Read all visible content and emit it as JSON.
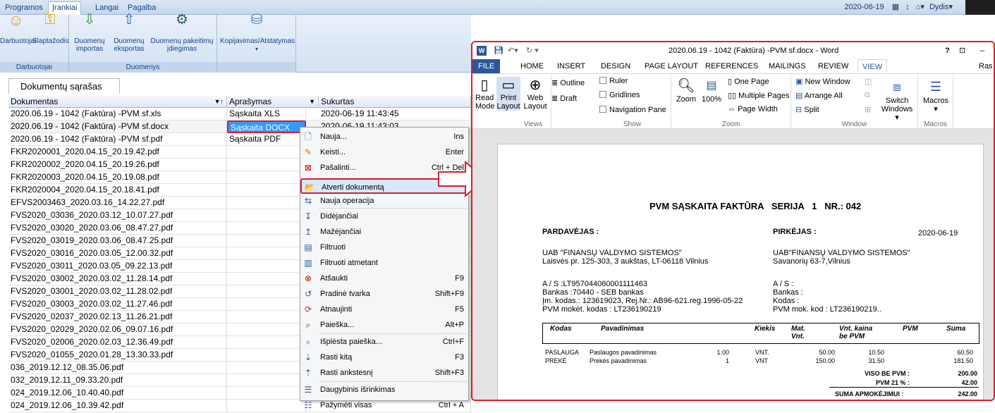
{
  "menubar": {
    "tabs": [
      "Programos",
      "Įrankiai",
      "Langai",
      "Pagalba"
    ],
    "date": "2020-06-19",
    "user": "Dydis"
  },
  "ribbon": {
    "groups": [
      {
        "label": "Darbuotojai",
        "buttons": [
          "Darbuotojai",
          "Slaptažodis"
        ]
      },
      {
        "label": "Duomenys",
        "buttons": [
          "Duomenų importas",
          "Duomenų eksportas",
          "Duomenų pakeitimų įdiegimas"
        ]
      },
      {
        "label": "",
        "buttons": [
          "Kopijavimas/Atstatymas"
        ]
      }
    ]
  },
  "list": {
    "title": "Dokumentų sąrašas",
    "columns": [
      "Dokumentas",
      "Aprašymas",
      "Sukurtas"
    ],
    "rows": [
      [
        "2020.06.19 - 1042 (Faktūra) -PVM sf.xls",
        "Sąskaita XLS",
        "2020-06-19 11:43:45"
      ],
      [
        "2020.06.19 - 1042 (Faktūra) -PVM sf.docx",
        "Sąskaita DOCX",
        "2020-06-19 11:43:03"
      ],
      [
        "2020.06.19 - 1042 (Faktūra) -PVM sf.pdf",
        "Sąskaita PDF",
        ""
      ],
      [
        "FKR2020001_2020.04.15_20.19.42.pdf",
        "",
        ""
      ],
      [
        "FKR2020002_2020.04.15_20.19.26.pdf",
        "",
        ""
      ],
      [
        "FKR2020003_2020.04.15_20.19.08.pdf",
        "",
        ""
      ],
      [
        "FKR2020004_2020.04.15_20.18.41.pdf",
        "",
        ""
      ],
      [
        "EFVS2003463_2020.03.16_14.22.27.pdf",
        "",
        ""
      ],
      [
        "FVS2020_03036_2020.03.12_10.07.27.pdf",
        "",
        ""
      ],
      [
        "FVS2020_03020_2020.03.06_08.47.27.pdf",
        "",
        ""
      ],
      [
        "FVS2020_03019_2020.03.06_08.47.25.pdf",
        "",
        ""
      ],
      [
        "FVS2020_03016_2020.03.05_12.00.32.pdf",
        "",
        ""
      ],
      [
        "FVS2020_03011_2020.03.05_09.22.13.pdf",
        "",
        ""
      ],
      [
        "FVS2020_03002_2020.03.02_11.28.14.pdf",
        "",
        ""
      ],
      [
        "FVS2020_03001_2020.03.02_11.28.02.pdf",
        "",
        ""
      ],
      [
        "FVS2020_03003_2020.03.02_11.27.46.pdf",
        "",
        ""
      ],
      [
        "FVS2020_02037_2020.02.13_11.26.21.pdf",
        "",
        ""
      ],
      [
        "FVS2020_02029_2020.02.06_09.07.16.pdf",
        "",
        ""
      ],
      [
        "FVS2020_02006_2020.02.03_12.36.49.pdf",
        "",
        ""
      ],
      [
        "FVS2020_01055_2020.01.28_13.30.33.pdf",
        "",
        ""
      ],
      [
        "036_2019.12.12_08.35.06.pdf",
        "",
        ""
      ],
      [
        "032_2019.12.11_09.33.20.pdf",
        "",
        ""
      ],
      [
        "024_2019.12.06_10.40.40.pdf",
        "",
        ""
      ],
      [
        "024_2019.12.06_10.39.42.pdf",
        "",
        ""
      ]
    ]
  },
  "context_menu": {
    "items": [
      {
        "label": "Nauja...",
        "shortcut": "Ins",
        "icon": "new-doc-icon"
      },
      {
        "label": "Keisti...",
        "shortcut": "Enter",
        "icon": "edit-icon"
      },
      {
        "label": "Pašalinti...",
        "shortcut": "Ctrl + Del",
        "icon": "delete-icon"
      },
      {
        "label": "Atverti dokumentą",
        "shortcut": "",
        "icon": "open-doc-icon"
      },
      {
        "label": "Nauja operacija",
        "shortcut": "",
        "icon": "operation-icon"
      },
      {
        "label": "Didėjančiai",
        "shortcut": "",
        "icon": "sort-asc-icon"
      },
      {
        "label": "Mažėjančiai",
        "shortcut": "",
        "icon": "sort-desc-icon"
      },
      {
        "label": "Filtruoti",
        "shortcut": "",
        "icon": "filter-icon"
      },
      {
        "label": "Filtruoti atmetant",
        "shortcut": "",
        "icon": "filter-exclude-icon"
      },
      {
        "label": "Atšaukti",
        "shortcut": "F9",
        "icon": "cancel-icon"
      },
      {
        "label": "Pradinė tvarka",
        "shortcut": "Shift+F9",
        "icon": "reset-order-icon"
      },
      {
        "label": "Atnaujinti",
        "shortcut": "F5",
        "icon": "refresh-icon"
      },
      {
        "label": "Paieška...",
        "shortcut": "Alt+P",
        "icon": "search-icon"
      },
      {
        "label": "Išplėsta paieška...",
        "shortcut": "Ctrl+F",
        "icon": "advanced-search-icon"
      },
      {
        "label": "Rasti kitą",
        "shortcut": "F3",
        "icon": "find-next-icon"
      },
      {
        "label": "Rasti ankstesnį",
        "shortcut": "Shift+F3",
        "icon": "find-prev-icon"
      },
      {
        "label": "Daugybinis išrinkimas",
        "shortcut": "",
        "icon": "multi-select-icon"
      },
      {
        "label": "Pažymėti visas",
        "shortcut": "Ctrl + A",
        "icon": "select-all-icon"
      }
    ]
  },
  "word": {
    "title": "2020.06.19 - 1042 (Faktūra) -PVM sf.docx - Word",
    "tabs": [
      "FILE",
      "HOME",
      "INSERT",
      "DESIGN",
      "PAGE LAYOUT",
      "REFERENCES",
      "MAILINGS",
      "REVIEW",
      "VIEW"
    ],
    "active_tab": "VIEW",
    "user_trunc": "Ras",
    "ribbon": {
      "views": {
        "label": "Views",
        "read": "Read Mode",
        "print": "Print Layout",
        "web": "Web Layout",
        "outline": "Outline",
        "draft": "Draft"
      },
      "show": {
        "label": "Show",
        "ruler": "Ruler",
        "gridlines": "Gridlines",
        "nav": "Navigation Pane"
      },
      "zoom": {
        "label": "Zoom",
        "zoom": "Zoom",
        "pct": "100%",
        "one": "One Page",
        "multi": "Multiple Pages",
        "width": "Page Width"
      },
      "window": {
        "label": "Window",
        "new": "New Window",
        "arrange": "Arrange All",
        "split": "Split",
        "switch": "Switch Windows"
      },
      "macros": {
        "label": "Macros",
        "macros": "Macros"
      }
    }
  },
  "invoice": {
    "title": "PVM SĄSKAITA FAKTŪRA   SERIJA   1   NR.: 042",
    "seller_hdr": "PARDAVĖJAS :",
    "buyer_hdr": "PIRKĖJAS :",
    "date": "2020-06-19",
    "seller_name": "UAB \"FINANSŲ VALDYMO SISTEMOS\"",
    "seller_addr": "Laisvės pr. 125-303, 3 aukštas, LT-06118 Vilnius",
    "buyer_name": "UAB\"FINANSŲ VALDYMO SISTEMOS\"",
    "buyer_addr": "Savanorių 63-7,Vilnius",
    "seller_as": "A / S :LT957044060001111463",
    "seller_bank": "Bankas :70440 - SEB bankas",
    "seller_im": "Įm. kodas.: 123619023, Rej.Nr.: AB96-621.reg.1996-05-22",
    "seller_pvm": "PVM mokėt. kodas : LT236190219",
    "buyer_as": "A / S :",
    "buyer_bank": "Bankas :",
    "buyer_kod": "Kodas :",
    "buyer_pvm": "PVM mok. kod : LT236190219..",
    "cols": [
      "Kodas",
      "Pavadinimas",
      "Kiekis",
      "Mat. Vnt.",
      "Vnt. kaina be PVM",
      "PVM",
      "Suma"
    ],
    "rows": [
      {
        "code": "PASLAUGA",
        "name": "Paslaugos pavadinimas",
        "qty": "1.00",
        "unit": "VNT.",
        "price": "50.00",
        "vat": "10.50",
        "sum": "60.50"
      },
      {
        "code": "PREKĖ",
        "name": "Prekės pavadinimas",
        "qty": "1",
        "unit": "VNT",
        "price": "150.00",
        "vat": "31.50",
        "sum": "181.50"
      }
    ],
    "viso_lbl": "VISO BE PVM :",
    "viso": "200.00",
    "pvm_lbl": "PVM 21 % :",
    "pvm": "42.00",
    "suma_lbl": "SUMA APMOKĖJIMUI :",
    "suma": "242.00"
  },
  "colors": {
    "accent_red": "#d9202b",
    "word_blue": "#2b579a",
    "selection": "#3399ff"
  }
}
